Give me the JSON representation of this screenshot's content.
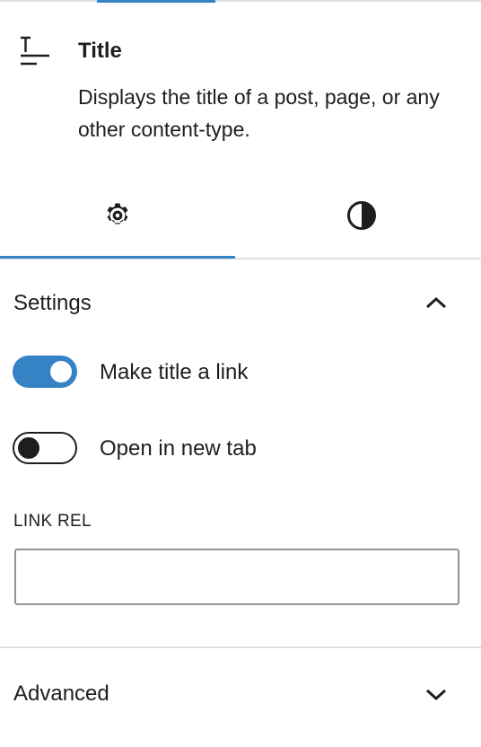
{
  "block": {
    "title": "Title",
    "description": "Displays the title of a post, page, or any other content-type.",
    "icon": "title-block-icon"
  },
  "tabs": [
    {
      "icon": "gear-icon",
      "selected": true
    },
    {
      "icon": "contrast-icon",
      "selected": false
    }
  ],
  "settings_panel": {
    "title": "Settings",
    "expanded": true,
    "toggles": [
      {
        "label": "Make title a link",
        "checked": true
      },
      {
        "label": "Open in new tab",
        "checked": false
      }
    ],
    "link_rel": {
      "label": "LINK REL",
      "value": ""
    }
  },
  "advanced_panel": {
    "title": "Advanced",
    "expanded": false
  },
  "colors": {
    "accent": "#3582c4",
    "text": "#1e1e1e",
    "border": "#e0e0e0"
  }
}
